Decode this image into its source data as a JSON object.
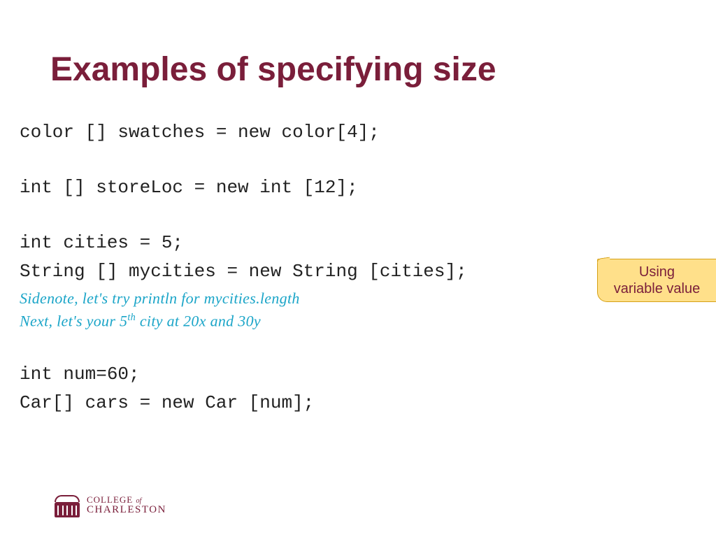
{
  "title": "Examples of specifying size",
  "code": {
    "line1": "color [] swatches  = new color[4];",
    "line2": "int [] storeLoc = new int [12];",
    "line3": "int cities = 5;",
    "line4": "String [] mycities = new String [cities];",
    "line5": "int num=60;",
    "line6": "Car[] cars = new Car [num];"
  },
  "notes": {
    "n1_pre": "Sidenote, let's try println for mycities.length",
    "n2_pre": "Next, let's your 5",
    "n2_sup": "th",
    "n2_post": " city at 20x and 30y"
  },
  "callout": {
    "line1": "Using",
    "line2": "variable value"
  },
  "logo": {
    "row1a": "COLLEGE",
    "row1of": "of",
    "row2": "CHARLESTON"
  }
}
